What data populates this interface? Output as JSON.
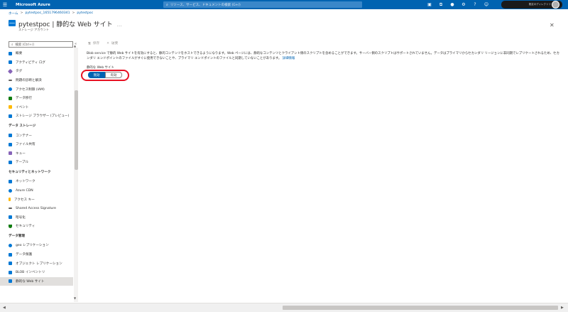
{
  "topbar": {
    "brand": "Microsoft Azure",
    "search_placeholder": "リソース、サービス、ドキュメントの検索 (G+/)",
    "account_directory": "既定のディレクトリ"
  },
  "breadcrumb": {
    "home": "ホーム",
    "resource_group": "pytestpoc_1651796460341",
    "current": "pytestpoc"
  },
  "header": {
    "title": "pytestpoc | 静的な Web サイト",
    "more": "…",
    "subtitle": "ストレージ アカウント"
  },
  "sidebar": {
    "search_placeholder": "検索 (Ctrl+/)",
    "collapse": "«",
    "items_top": [
      {
        "label": "概要",
        "icon": "overview-icon",
        "color": "#0078d4"
      },
      {
        "label": "アクティビティ ログ",
        "icon": "activity-log-icon",
        "color": "#0078d4"
      },
      {
        "label": "タグ",
        "icon": "tag-icon",
        "color": "#8764b8"
      },
      {
        "label": "問題の診断と解決",
        "icon": "wrench-icon",
        "color": "#605e5c"
      },
      {
        "label": "アクセス制御 (IAM)",
        "icon": "iam-icon",
        "color": "#0078d4"
      },
      {
        "label": "データ移行",
        "icon": "data-migration-icon",
        "color": "#107c10"
      },
      {
        "label": "イベント",
        "icon": "lightning-icon",
        "color": "#ffb900"
      },
      {
        "label": "ストレージ ブラウザー (プレビュー)",
        "icon": "storage-browser-icon",
        "color": "#0078d4"
      }
    ],
    "section_data_storage": "データ ストレージ",
    "items_data_storage": [
      {
        "label": "コンテナー",
        "icon": "container-icon",
        "color": "#0078d4"
      },
      {
        "label": "ファイル共有",
        "icon": "file-share-icon",
        "color": "#0078d4"
      },
      {
        "label": "キュー",
        "icon": "queue-icon",
        "color": "#8764b8"
      },
      {
        "label": "テーブル",
        "icon": "table-icon",
        "color": "#0078d4"
      }
    ],
    "section_security": "セキュリティとネットワーク",
    "items_security": [
      {
        "label": "ネットワーク",
        "icon": "network-icon",
        "color": "#0078d4"
      },
      {
        "label": "Azure CDN",
        "icon": "cdn-icon",
        "color": "#0078d4"
      },
      {
        "label": "アクセス キー",
        "icon": "key-icon",
        "color": "#ffb900"
      },
      {
        "label": "Shared Access Signature",
        "icon": "link-icon",
        "color": "#605e5c"
      },
      {
        "label": "暗号化",
        "icon": "lock-icon",
        "color": "#0078d4"
      },
      {
        "label": "セキュリティ",
        "icon": "shield-icon",
        "color": "#107c10"
      }
    ],
    "section_data_mgmt": "データ管理",
    "items_data_mgmt": [
      {
        "label": "geo レプリケーション",
        "icon": "geo-replication-icon",
        "color": "#0078d4"
      },
      {
        "label": "データ保護",
        "icon": "data-protection-icon",
        "color": "#0078d4"
      },
      {
        "label": "オブジェクト レプリケーション",
        "icon": "object-replication-icon",
        "color": "#0078d4"
      },
      {
        "label": "BLOB インベントリ",
        "icon": "blob-inventory-icon",
        "color": "#0078d4"
      },
      {
        "label": "静的な Web サイト",
        "icon": "static-website-icon",
        "color": "#0078d4"
      }
    ]
  },
  "commandbar": {
    "save": "保存",
    "discard": "破棄"
  },
  "main": {
    "description": "Blob service で静的 Web サイトを有効にすると、静的コンテンツをホストできるようになります。Web ページには、静的なコンテンツとクライアント側のスクリプトを含めることができます。サーバー側のスクリプトはサポートされていません。データはプライマリからセカンダリ リージョンに非同期でレプリケートされるため、セカンダリ エンドポイントのファイルがすぐに使用できないことや、プライマリ エンドポイントのファイルと同期していないことがあります。",
    "learn_more": "詳細情報",
    "field_label": "静的な Web サイト",
    "toggle_enabled": "無効",
    "toggle_disabled": "有効"
  }
}
